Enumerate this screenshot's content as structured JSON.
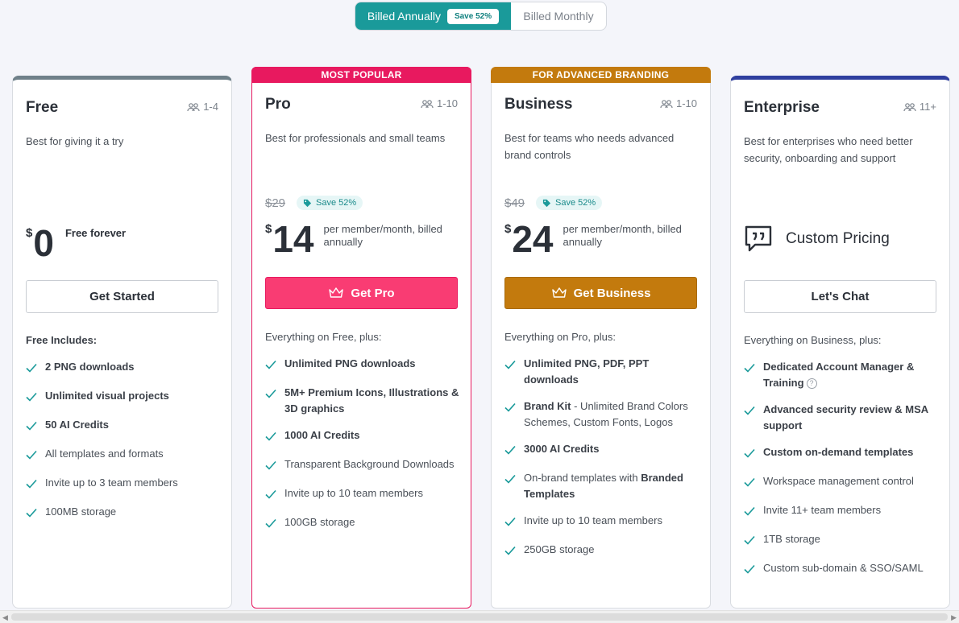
{
  "billing": {
    "annual_label": "Billed Annually",
    "annual_badge": "Save 52%",
    "monthly_label": "Billed Monthly"
  },
  "colors": {
    "teal": "#1a9a9a",
    "pro_pink": "#e8195f",
    "business_orange": "#c37a0d",
    "enterprise_blue": "#2f3f9f",
    "check_green": "#1a9a9a"
  },
  "plans": {
    "free": {
      "title": "Free",
      "team": "1-4",
      "desc": "Best for giving it a try",
      "currency": "$",
      "amount": "0",
      "per": "Free forever",
      "button": "Get Started",
      "includes": "Free Includes:",
      "features": [
        "2 PNG downloads",
        "Unlimited visual projects",
        "50 AI Credits",
        "All templates and formats",
        "Invite up to 3 team members",
        "100MB storage"
      ]
    },
    "pro": {
      "ribbon": "MOST POPULAR",
      "title": "Pro",
      "team": "1-10",
      "desc": "Best for professionals and small teams",
      "old_price": "$29",
      "save": "Save 52%",
      "currency": "$",
      "amount": "14",
      "per": "per member/month, billed annually",
      "button": "Get Pro",
      "includes": "Everything on Free, plus:",
      "features": [
        "Unlimited PNG downloads",
        "5M+ Premium Icons, Illustrations & 3D graphics",
        "1000 AI Credits",
        "Transparent Background Downloads",
        "Invite up to 10 team members",
        "100GB storage"
      ]
    },
    "business": {
      "ribbon": "FOR ADVANCED BRANDING",
      "title": "Business",
      "team": "1-10",
      "desc": "Best for teams who needs advanced brand controls",
      "old_price": "$49",
      "save": "Save 52%",
      "currency": "$",
      "amount": "24",
      "per": "per member/month, billed annually",
      "button": "Get Business",
      "includes": "Everything on Pro, plus:",
      "f1": "Unlimited PNG, PDF, PPT downloads",
      "f2_bold": "Brand Kit",
      "f2_rest": " - Unlimited Brand Colors Schemes, Custom Fonts, Logos",
      "f3": "3000 AI Credits",
      "f4_rest": "On-brand templates with ",
      "f4_bold": "Branded Templates",
      "f5": "Invite up to 10 team members",
      "f6": "250GB storage"
    },
    "enterprise": {
      "title": "Enterprise",
      "team": "11+",
      "desc": "Best for enterprises who need better security, onboarding and support",
      "custom_pricing": "Custom Pricing",
      "button": "Let's Chat",
      "includes": "Everything on Business, plus:",
      "f1": "Dedicated Account Manager & Training",
      "help": "?",
      "features": [
        "Advanced security review & MSA support",
        "Custom on-demand templates",
        "Workspace management control",
        "Invite 11+ team members",
        "1TB storage",
        "Custom sub-domain & SSO/SAML"
      ]
    }
  }
}
